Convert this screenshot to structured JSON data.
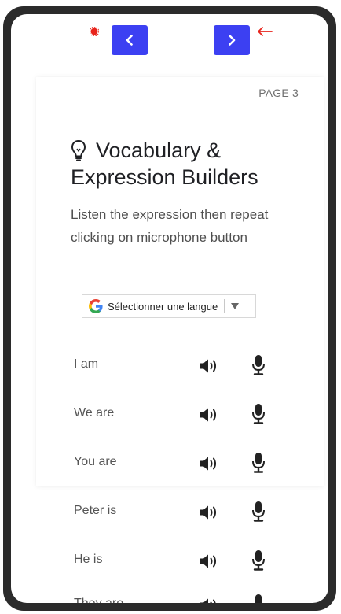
{
  "nav": {
    "prev_label": "<",
    "next_label": ">"
  },
  "page_label": "PAGE 3",
  "title_line1": "Vocabulary &",
  "title_line2": "Expression Builders",
  "description": "Listen the expression then repeat clicking on microphone button",
  "translate": {
    "label": "Sélectionner une langue"
  },
  "expressions": [
    {
      "text": "I am"
    },
    {
      "text": "We are"
    },
    {
      "text": "You are"
    },
    {
      "text": "Peter is"
    },
    {
      "text": "He is"
    },
    {
      "text": "They are"
    }
  ],
  "colors": {
    "accent": "#3c40f2",
    "annotation": "#e8241c",
    "frame": "#2b2b2b"
  },
  "icons": {
    "speaker": "speaker-icon",
    "mic": "microphone-icon",
    "bulb": "lightbulb-icon"
  }
}
